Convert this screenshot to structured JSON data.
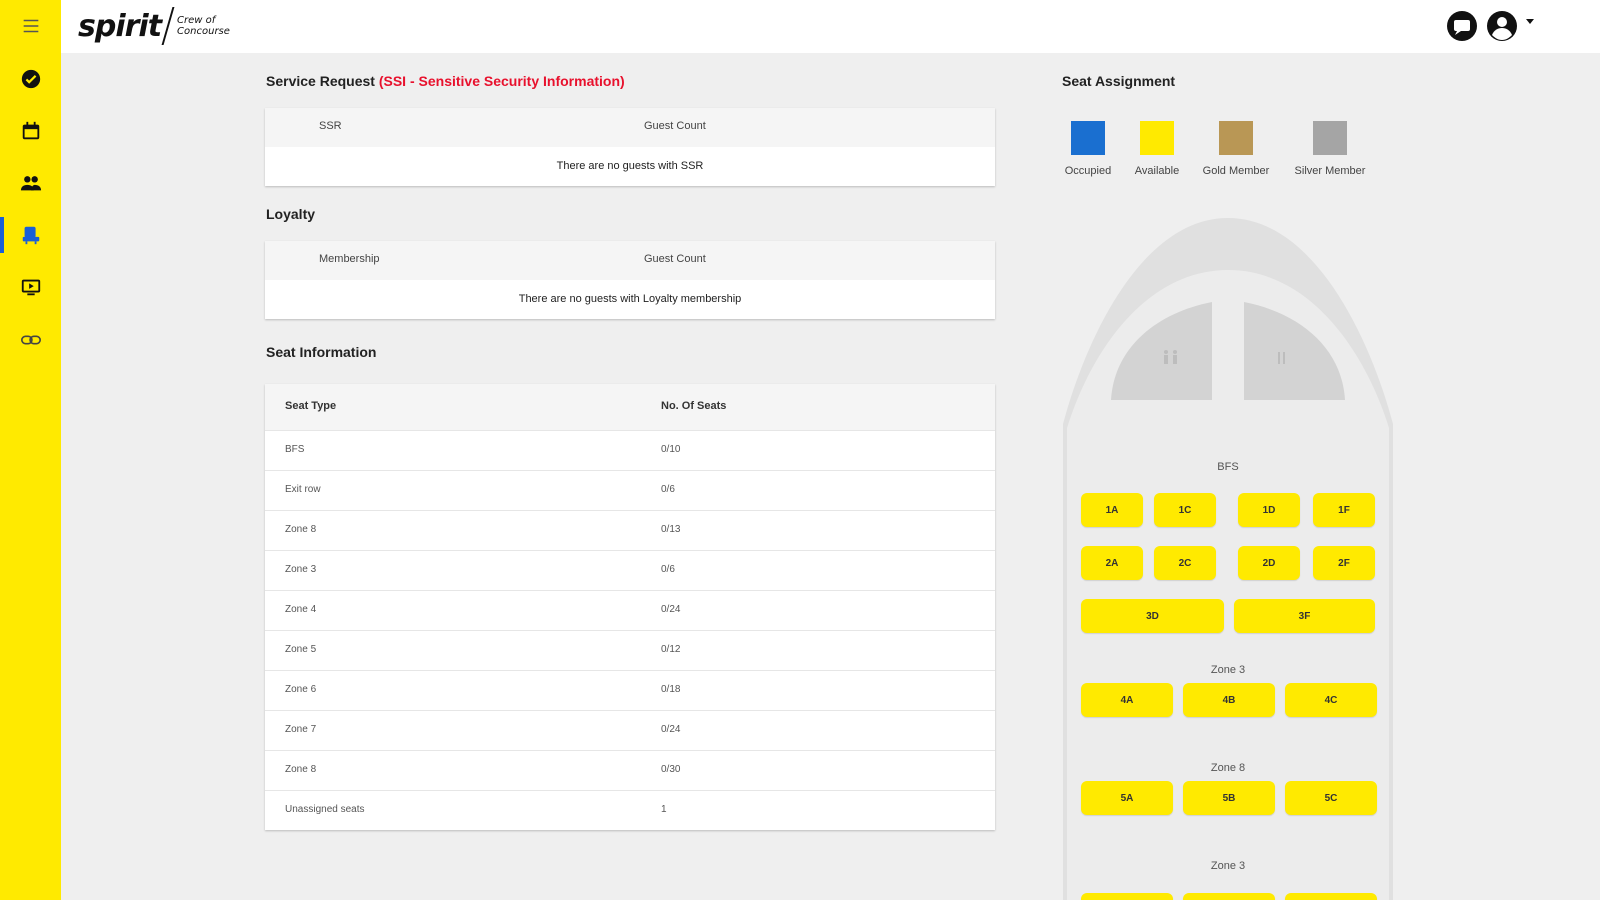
{
  "brand": {
    "logo_word": "spirit",
    "logo_tagline_1": "Crew of",
    "logo_tagline_2": "Concourse"
  },
  "colors": {
    "sidebar_bg": "#ffea00",
    "accent": "#1a5fd6",
    "sensitive_text": "#e8112d",
    "occupied": "#1a6fd0",
    "available": "#ffea00",
    "gold_member": "#b99755",
    "silver_member": "#a5a5a5"
  },
  "sidebar": {
    "items": [
      {
        "icon": "menu-icon"
      },
      {
        "icon": "check-circle-icon"
      },
      {
        "icon": "calendar-icon"
      },
      {
        "icon": "people-icon"
      },
      {
        "icon": "seat-icon",
        "active": true
      },
      {
        "icon": "video-icon"
      },
      {
        "icon": "link-icon"
      }
    ]
  },
  "header": {
    "icons": [
      "chat-icon",
      "user-account-icon",
      "chevron-down-icon"
    ]
  },
  "service_request": {
    "title": "Service Request",
    "sensitive_note": "(SSI - Sensitive Security Information)",
    "columns": [
      "SSR",
      "Guest Count"
    ],
    "empty_message": "There are no guests with SSR"
  },
  "loyalty": {
    "title": "Loyalty",
    "columns": [
      "Membership",
      "Guest Count"
    ],
    "empty_message": "There are no guests with Loyalty membership"
  },
  "seat_information": {
    "title": "Seat Information",
    "columns": [
      "Seat Type",
      "No. Of Seats"
    ],
    "rows": [
      {
        "type": "BFS",
        "count": "0/10"
      },
      {
        "type": "Exit row",
        "count": "0/6"
      },
      {
        "type": "Zone 8",
        "count": "0/13"
      },
      {
        "type": "Zone 3",
        "count": "0/6"
      },
      {
        "type": "Zone 4",
        "count": "0/24"
      },
      {
        "type": "Zone 5",
        "count": "0/12"
      },
      {
        "type": "Zone 6",
        "count": "0/18"
      },
      {
        "type": "Zone 7",
        "count": "0/24"
      },
      {
        "type": "Zone 8",
        "count": "0/30"
      },
      {
        "type": "Unassigned seats",
        "count": "1"
      }
    ]
  },
  "seat_assignment": {
    "title": "Seat Assignment",
    "legend": [
      "Occupied",
      "Available",
      "Gold Member",
      "Silver Member"
    ],
    "zones": [
      {
        "label": "BFS",
        "seats": [
          "1A",
          "1C",
          "1D",
          "1F",
          "2A",
          "2C",
          "2D",
          "2F",
          "3D",
          "3F"
        ]
      },
      {
        "label": "Zone 3",
        "seats": [
          "4A",
          "4B",
          "4C"
        ]
      },
      {
        "label": "Zone 8",
        "seats": [
          "5A",
          "5B",
          "5C"
        ]
      },
      {
        "label": "Zone 3",
        "seats": []
      }
    ]
  }
}
